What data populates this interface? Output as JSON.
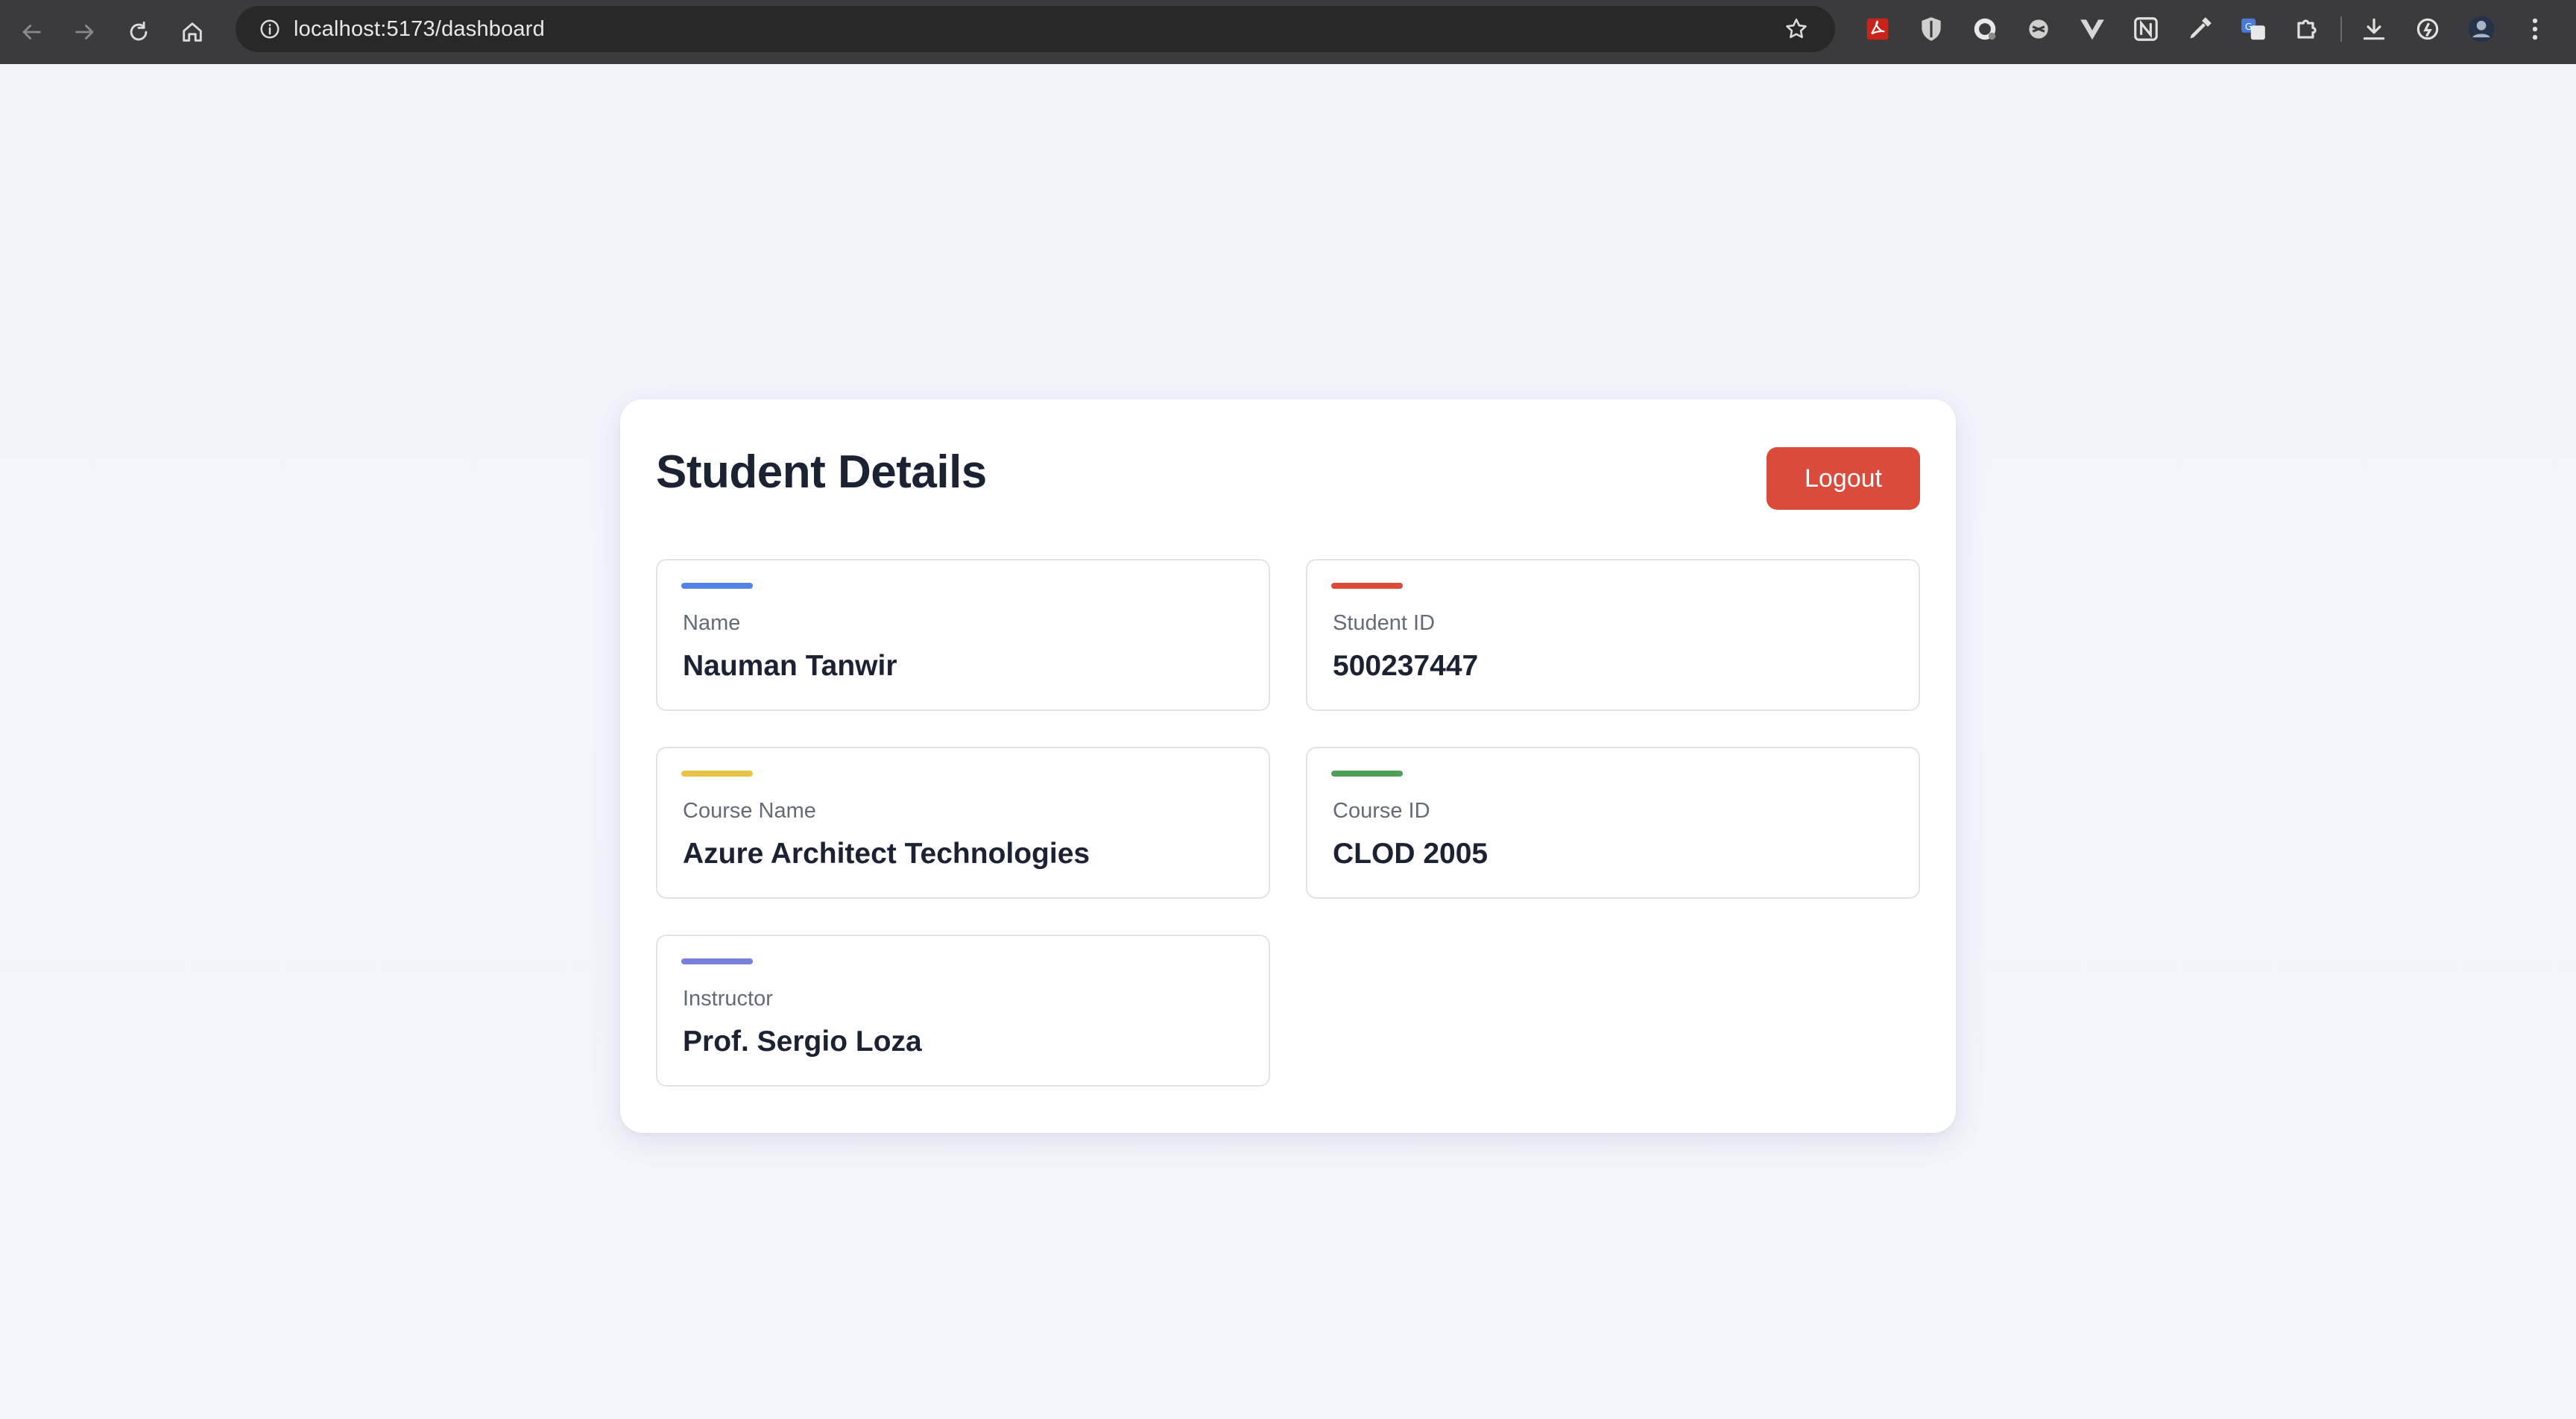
{
  "browser": {
    "url": "localhost:5173/dashboard",
    "nav": [
      "back-icon",
      "forward-icon",
      "reload-icon",
      "home-icon"
    ],
    "extensions": [
      "pdf-icon",
      "shield-icon",
      "extension-icon",
      "extension-icon",
      "vue-icon",
      "notion-icon",
      "color-picker-icon",
      "translate-icon",
      "puzzle-icon",
      "download-icon",
      "sync-icon",
      "avatar",
      "more-icon"
    ]
  },
  "dashboard": {
    "title": "Student Details",
    "logout_label": "Logout",
    "logout_color": "#db4b3c",
    "fields": [
      {
        "label": "Name",
        "value": "Nauman Tanwir",
        "accent": "#5381e6"
      },
      {
        "label": "Student ID",
        "value": "500237447",
        "accent": "#db4b3c"
      },
      {
        "label": "Course Name",
        "value": "Azure Architect Technologies",
        "accent": "#e8c446"
      },
      {
        "label": "Course ID",
        "value": "CLOD 2005",
        "accent": "#4f9e57"
      },
      {
        "label": "Instructor",
        "value": "Prof. Sergio Loza",
        "accent": "#7a7fdc"
      }
    ]
  }
}
